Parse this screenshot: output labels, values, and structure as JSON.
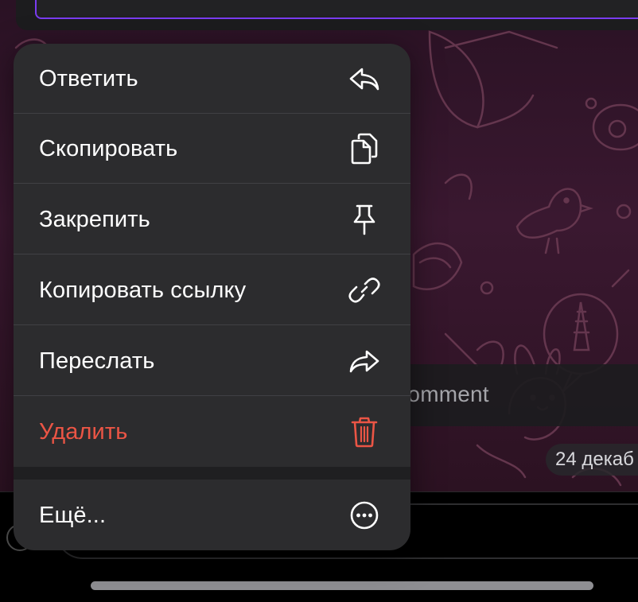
{
  "chat": {
    "comment_placeholder": "Comment",
    "date_badge": "24 декаб"
  },
  "context_menu": {
    "items": [
      {
        "label": "Ответить",
        "icon": "reply-icon",
        "destructive": false
      },
      {
        "label": "Скопировать",
        "icon": "copy-icon",
        "destructive": false
      },
      {
        "label": "Закрепить",
        "icon": "pin-icon",
        "destructive": false
      },
      {
        "label": "Копировать ссылку",
        "icon": "link-icon",
        "destructive": false
      },
      {
        "label": "Переслать",
        "icon": "forward-icon",
        "destructive": false
      },
      {
        "label": "Удалить",
        "icon": "trash-icon",
        "destructive": true
      }
    ],
    "more": {
      "label": "Ещё...",
      "icon": "more-icon"
    }
  },
  "colors": {
    "menu_background": "#2c2c2e",
    "destructive": "#eb5545",
    "text": "#ffffff",
    "input_border_accent": "#7a3cf0",
    "wallpaper": "#3a1830"
  }
}
